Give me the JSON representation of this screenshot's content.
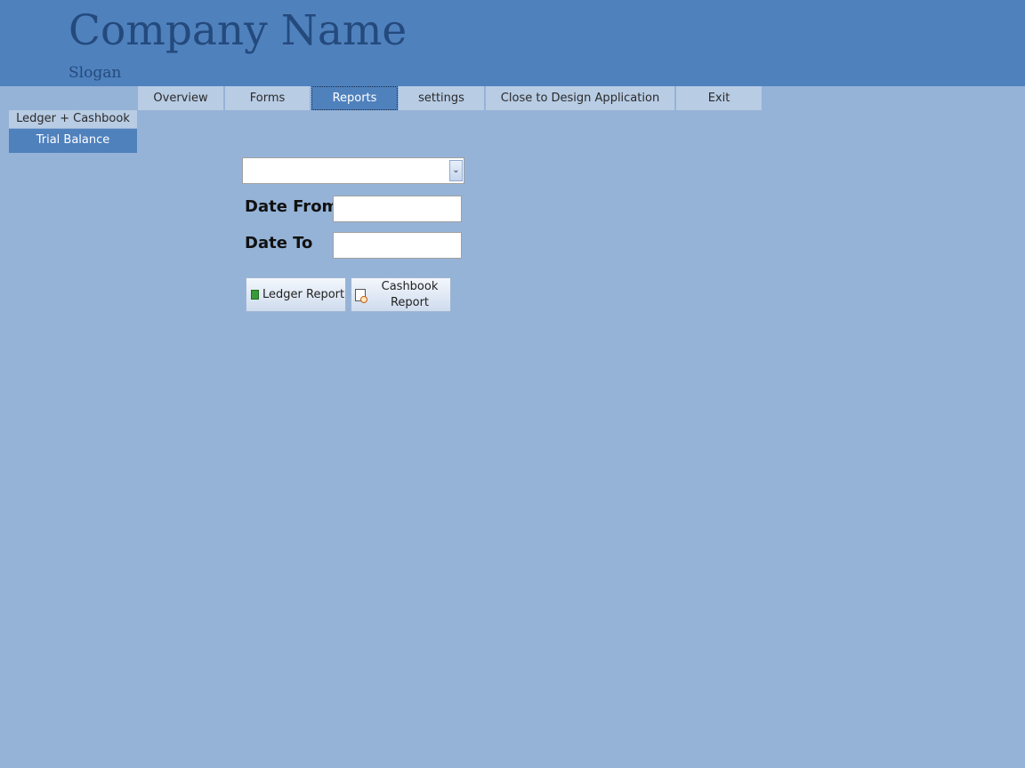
{
  "header": {
    "company_name": "Company Name",
    "slogan": "Slogan"
  },
  "nav": {
    "tabs": [
      {
        "label": "Overview",
        "active": false
      },
      {
        "label": "Forms",
        "active": false
      },
      {
        "label": "Reports",
        "active": true
      },
      {
        "label": "settings",
        "active": false
      },
      {
        "label": "Close to Design Application",
        "active": false
      },
      {
        "label": "Exit",
        "active": false
      }
    ]
  },
  "sidebar": {
    "items": [
      {
        "label": "Ledger + Cashbook",
        "selected": false
      },
      {
        "label": "Trial Balance",
        "selected": true
      }
    ]
  },
  "form": {
    "combo_value": "",
    "date_from_label": "Date From",
    "date_from_value": "",
    "date_to_label": "Date To",
    "date_to_value": "",
    "ledger_button_label": "Ledger Report",
    "cashbook_button_label_line1": "Cashbook",
    "cashbook_button_label_line2": "Report"
  },
  "colors": {
    "background": "#95b3d7",
    "header": "#4f81bd",
    "tab": "#b8cce4",
    "accent_text": "#244a7d"
  },
  "icons": {
    "ledger_button_icon": "book-icon",
    "cashbook_button_icon": "report-preview-icon",
    "combo_icon": "chevron-down-icon"
  }
}
